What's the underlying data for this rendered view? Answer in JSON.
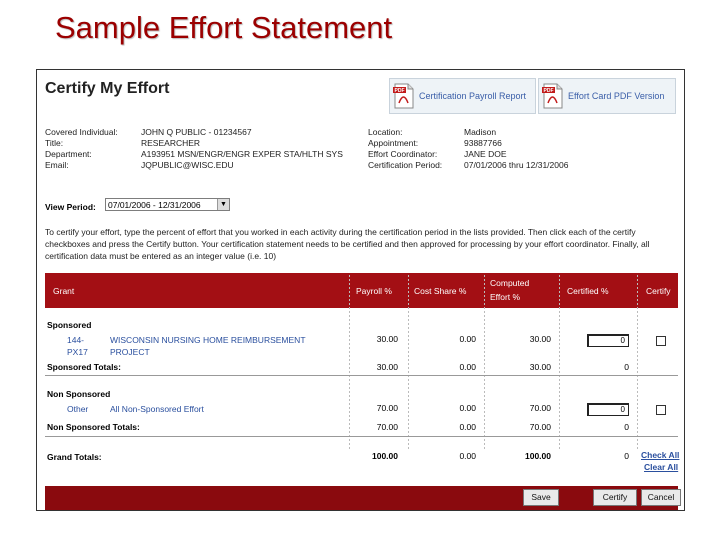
{
  "slide": {
    "title": "Sample Effort Statement"
  },
  "page": {
    "heading": "Certify My Effort"
  },
  "pdf_buttons": [
    {
      "label": "Certification Payroll Report",
      "icon": "pdf-file-icon"
    },
    {
      "label": "Effort Card PDF Version",
      "icon": "pdf-file-icon"
    }
  ],
  "info_left": {
    "labels": [
      "Covered Individual:",
      "Title:",
      "Department:",
      "Email:"
    ],
    "values": [
      "JOHN Q PUBLIC - 01234567",
      "RESEARCHER",
      "A193951 MSN/ENGR/ENGR EXPER STA/HLTH SYS",
      "JQPUBLIC@WISC.EDU"
    ]
  },
  "info_right": {
    "labels": [
      "Location:",
      "Appointment:",
      "Effort Coordinator:",
      "Certification Period:"
    ],
    "values": [
      "Madison",
      "93887766",
      "JANE DOE",
      "07/01/2006 thru 12/31/2006"
    ]
  },
  "view_period": {
    "label": "View Period:",
    "value": "07/01/2006 - 12/31/2006"
  },
  "instructions": "To certify your effort, type the percent of effort that you worked in each activity during the certification period in the lists provided. Then click each of the certify checkboxes and press the Certify button. Your certification statement needs to be certified and then approved for processing by your effort coordinator. Finally, all certification data must be entered as an integer value (i.e. 10)",
  "table": {
    "headers": {
      "grant": "Grant",
      "payroll": "Payroll %",
      "cost_share": "Cost Share %",
      "computed_1": "Computed",
      "computed_2": "Effort %",
      "certified": "Certified %",
      "certify": "Certify"
    },
    "sponsored": {
      "label": "Sponsored",
      "row": {
        "grant_1": "144-",
        "grant_2": "PX17",
        "desc_1": "WISCONSIN NURSING HOME REIMBURSEMENT",
        "desc_2": "PROJECT",
        "payroll": "30.00",
        "cost_share": "0.00",
        "computed": "30.00",
        "certified": "0"
      },
      "totals_label": "Sponsored Totals:",
      "totals": {
        "payroll": "30.00",
        "cost_share": "0.00",
        "computed": "30.00",
        "certified": "0"
      }
    },
    "non_sponsored": {
      "label": "Non Sponsored",
      "row": {
        "grant": "Other",
        "desc": "All Non-Sponsored Effort",
        "payroll": "70.00",
        "cost_share": "0.00",
        "computed": "70.00",
        "certified": "0"
      },
      "totals_label": "Non Sponsored Totals:",
      "totals": {
        "payroll": "70.00",
        "cost_share": "0.00",
        "computed": "70.00",
        "certified": "0"
      }
    },
    "grand": {
      "label": "Grand Totals:",
      "payroll": "100.00",
      "cost_share": "0.00",
      "computed": "100.00",
      "certified": "0"
    },
    "check_all": "Check All",
    "clear_all": "Clear All"
  },
  "footer_buttons": {
    "save": "Save",
    "certify": "Certify",
    "cancel": "Cancel"
  },
  "colors": {
    "title": "#9b0000",
    "header_bar": "#a30f14",
    "footer_bar": "#8a0a0e",
    "link": "#2a4f9e"
  }
}
